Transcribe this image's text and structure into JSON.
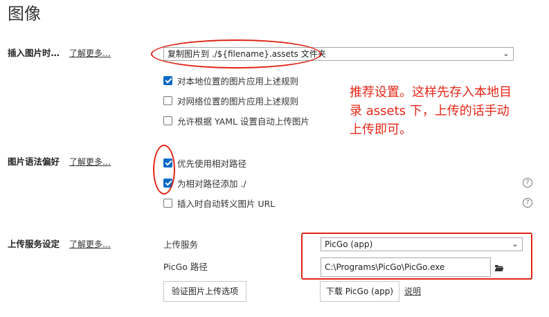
{
  "page": {
    "title": "图像"
  },
  "insert_section": {
    "label": "插入图片时…",
    "learn_more": "了解更多…",
    "dropdown_value": "复制图片到 ./${filename}.assets 文件夹",
    "options": [
      {
        "label": "对本地位置的图片应用上述规则",
        "checked": true
      },
      {
        "label": "对网络位置的图片应用上述规则",
        "checked": false
      },
      {
        "label": "允许根据 YAML 设置自动上传图片",
        "checked": false
      }
    ]
  },
  "syntax_section": {
    "label": "图片语法偏好",
    "learn_more": "了解更多…",
    "options": [
      {
        "label": "优先使用相对路径",
        "checked": true
      },
      {
        "label": "为相对路径添加 ./",
        "checked": true
      },
      {
        "label": "插入时自动转义图片 URL",
        "checked": false
      }
    ]
  },
  "upload_section": {
    "label": "上传服务设定",
    "learn_more": "了解更多…",
    "service_label": "上传服务",
    "service_value": "PicGo (app)",
    "path_label": "PicGo 路径",
    "path_value": "C:\\Programs\\PicGo\\PicGo.exe",
    "verify_button": "验证图片上传选项",
    "download_button": "下载 PicGo (app)",
    "explain_link": "说明"
  },
  "annotation": {
    "lines": [
      "推荐设置。这样先存入本地目",
      "录 assets 下，上传的话手动",
      "上传即可。"
    ],
    "color": "#e62617"
  },
  "colors": {
    "checkbox_checked": "#0b69c7",
    "highlight": "#e02417"
  }
}
